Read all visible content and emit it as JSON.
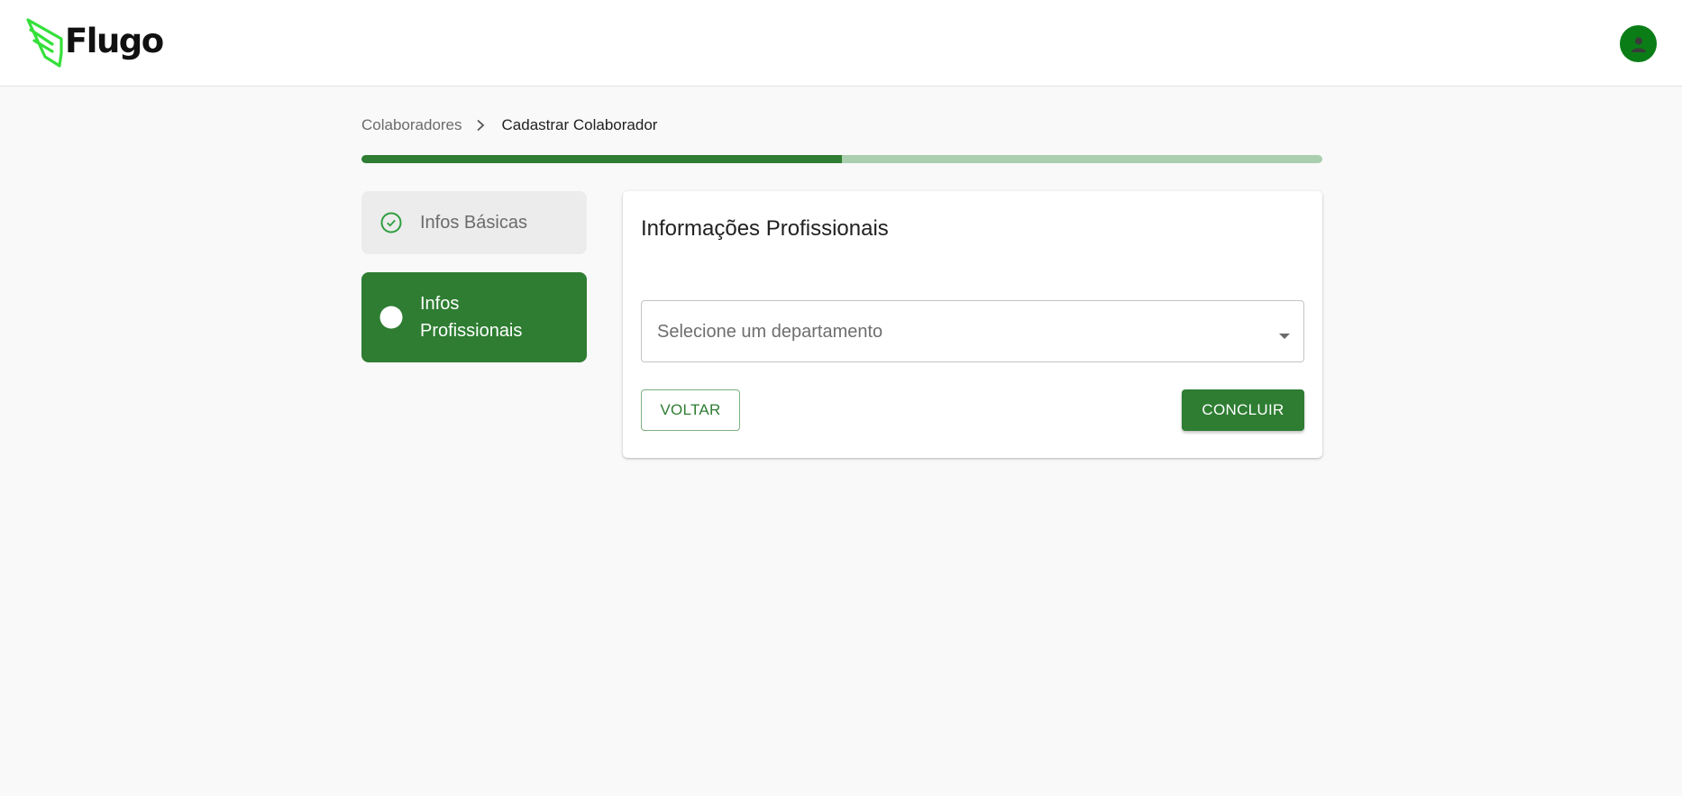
{
  "header": {
    "logo_text": "Flugo",
    "avatar_icon": "user-avatar-icon"
  },
  "breadcrumb": {
    "items": [
      "Colaboradores",
      "Cadastrar Colaborador"
    ]
  },
  "progress": {
    "percent": 50
  },
  "steps": [
    {
      "label": "Infos Básicas",
      "state": "completed",
      "icon": "check-circle-icon"
    },
    {
      "label": "Infos Profissionais",
      "state": "active",
      "icon": "circle-icon"
    }
  ],
  "form": {
    "title": "Informações Profissionais",
    "department_placeholder": "Selecione um departamento",
    "back_label": "VOLTAR",
    "finish_label": "CONCLUIR"
  },
  "colors": {
    "primary": "#2e7d32",
    "progress_track": "#a9cfae",
    "logo_green": "#3ee03e",
    "avatar_bg": "#0b7d17"
  }
}
